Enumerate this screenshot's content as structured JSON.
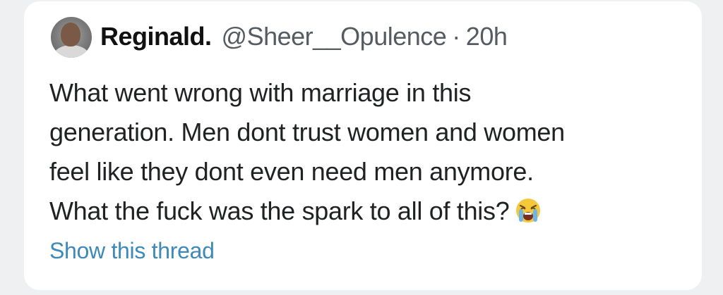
{
  "tweet": {
    "display_name": "Reginald.",
    "handle": "@Sheer__Opulence",
    "separator": "·",
    "time": "20h",
    "text_lines": [
      "What went wrong with marriage in this",
      "generation. Men dont trust women and women",
      "feel like they dont even need men anymore.",
      "What the fuck was the spark to all of this?"
    ],
    "emoji": "loudly-crying-face-icon",
    "show_thread": "Show this thread"
  },
  "colors": {
    "background": "#eef0f1",
    "card": "#ffffff",
    "text": "#1f2123",
    "secondary": "#555b60",
    "link": "#3d89b8"
  }
}
